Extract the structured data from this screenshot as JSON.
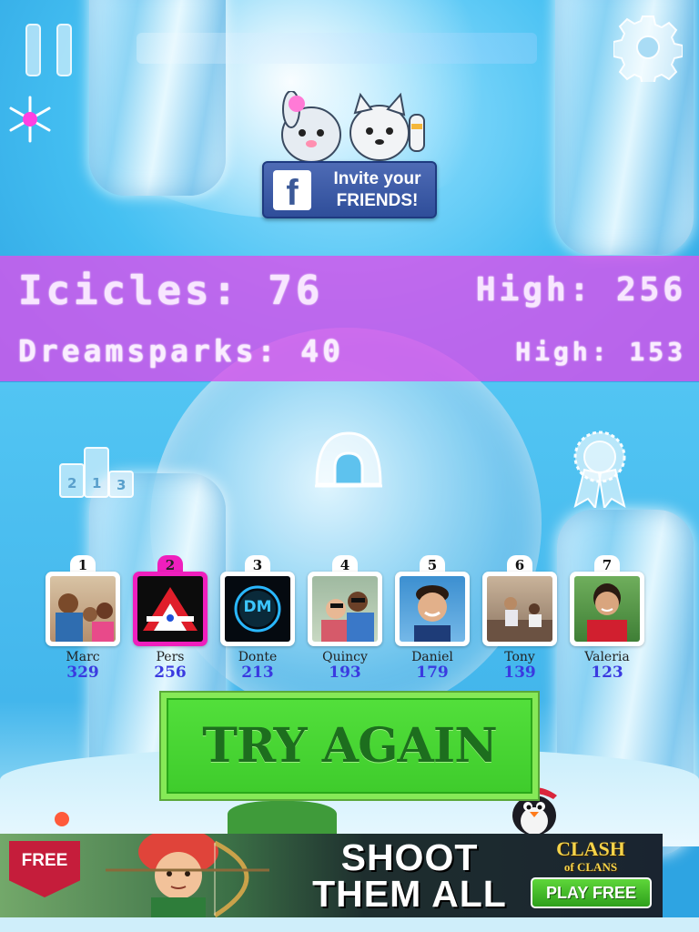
{
  "invite": {
    "line1": "Invite your",
    "line2": "FRIENDS!",
    "logo": "f"
  },
  "scores": {
    "icicles": "Icicles: 76",
    "icicles_high": "High: 256",
    "dreamsparks": "Dreamsparks: 40",
    "dreamsparks_high": "High: 153"
  },
  "menu_icons": {
    "leaderboard": {
      "icon": "podium-icon",
      "places": [
        "2",
        "1",
        "3"
      ]
    },
    "home": {
      "icon": "igloo-icon"
    },
    "achievements": {
      "icon": "ribbon-icon"
    }
  },
  "leaderboard": [
    {
      "rank": "1",
      "name": "Marc",
      "score": "329"
    },
    {
      "rank": "2",
      "name": "Pers",
      "score": "256",
      "is_player": true
    },
    {
      "rank": "3",
      "name": "Donte",
      "score": "213",
      "avatar_text": "DM"
    },
    {
      "rank": "4",
      "name": "Quincy",
      "score": "193"
    },
    {
      "rank": "5",
      "name": "Daniel",
      "score": "179"
    },
    {
      "rank": "6",
      "name": "Tony",
      "score": "139"
    },
    {
      "rank": "7",
      "name": "Valeria",
      "score": "123"
    }
  ],
  "try_again": {
    "label": "TRY AGAIN"
  },
  "ad": {
    "badge": "FREE",
    "headline_1": "SHOOT",
    "headline_2": "THEM ALL",
    "brand_1": "CLASH",
    "brand_2": "of CLANS",
    "cta": "PLAY FREE"
  },
  "colors": {
    "sky": "#3fb3ea",
    "score_band": "#d654eb",
    "player_highlight": "#ef1fbd",
    "try_again_green": "#52df3b",
    "facebook_blue": "#3b5998",
    "score_text_blue": "#3a3ae0"
  }
}
